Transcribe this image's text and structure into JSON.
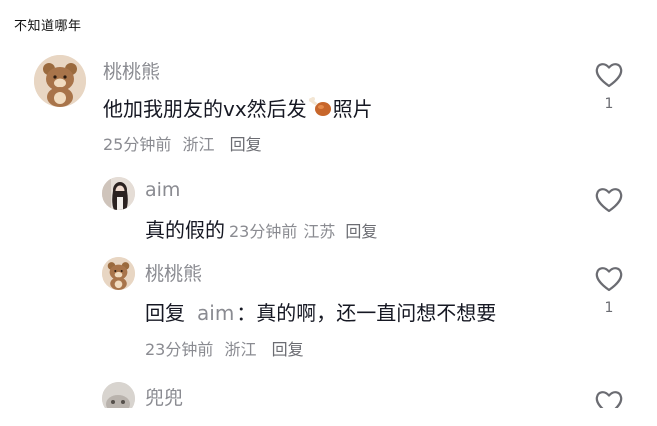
{
  "header": {
    "title": "不知道哪年"
  },
  "comments": [
    {
      "username": "桃桃熊",
      "text_before": "他加我朋友的vx然后发",
      "emoji": "drumstick",
      "text_after": "照片",
      "time": "25分钟前",
      "location": "浙江",
      "reply_label": "回复",
      "like_count": "1"
    },
    {
      "username": "aim",
      "text": "真的假的",
      "time": "23分钟前",
      "location": "江苏",
      "reply_label": "回复",
      "like_count": ""
    },
    {
      "username": "桃桃熊",
      "reply_prefix": "回复",
      "reply_to": "aim",
      "separator": "：",
      "text": "真的啊，还一直问想不想要",
      "time": "23分钟前",
      "location": "浙江",
      "reply_label": "回复",
      "like_count": "1"
    },
    {
      "username": "兜兜",
      "like_count": ""
    }
  ],
  "colors": {
    "primary_text": "#161823",
    "secondary_text": "#8a8b91",
    "background": "#ffffff"
  }
}
